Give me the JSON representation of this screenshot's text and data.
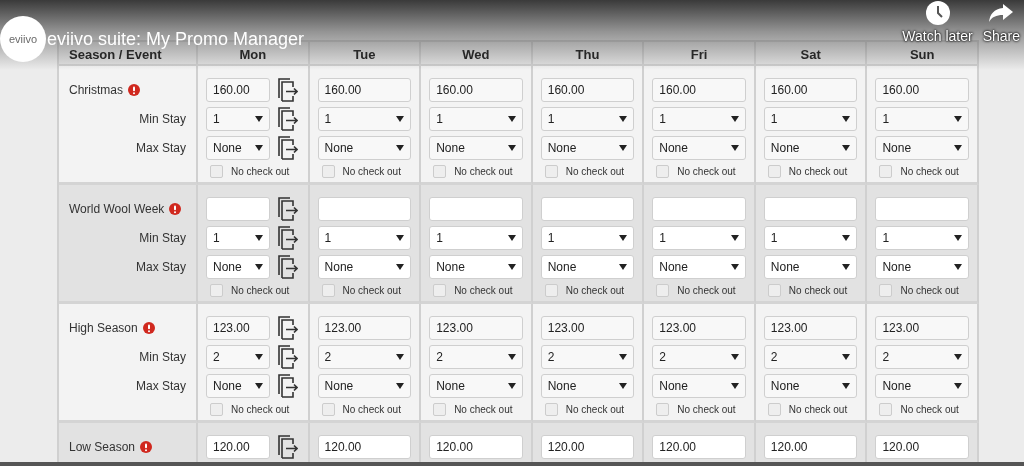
{
  "video": {
    "channel_logo": "eviivo",
    "title": "eviivo suite: My Promo Manager",
    "actions": [
      {
        "kind": "clock",
        "label": "Watch later"
      },
      {
        "kind": "share",
        "label": "Share"
      }
    ]
  },
  "table": {
    "columns": [
      "Season / Event",
      "Mon",
      "Tue",
      "Wed",
      "Thu",
      "Fri",
      "Sat",
      "Sun"
    ],
    "seasons": [
      {
        "name": "Christmas",
        "warning": true,
        "min_stay_label": "Min Stay",
        "max_stay_label": "Max Stay",
        "days": [
          {
            "rate": "160.00",
            "min_stay": "1",
            "max_stay": "None",
            "no_checkout_label": "No check out",
            "no_checkout": false
          },
          {
            "rate": "160.00",
            "min_stay": "1",
            "max_stay": "None",
            "no_checkout_label": "No check out",
            "no_checkout": false
          },
          {
            "rate": "160.00",
            "min_stay": "1",
            "max_stay": "None",
            "no_checkout_label": "No check out",
            "no_checkout": false
          },
          {
            "rate": "160.00",
            "min_stay": "1",
            "max_stay": "None",
            "no_checkout_label": "No check out",
            "no_checkout": false
          },
          {
            "rate": "160.00",
            "min_stay": "1",
            "max_stay": "None",
            "no_checkout_label": "No check out",
            "no_checkout": false
          },
          {
            "rate": "160.00",
            "min_stay": "1",
            "max_stay": "None",
            "no_checkout_label": "No check out",
            "no_checkout": false
          },
          {
            "rate": "160.00",
            "min_stay": "1",
            "max_stay": "None",
            "no_checkout_label": "No check out",
            "no_checkout": false
          }
        ]
      },
      {
        "name": "World Wool Week",
        "warning": true,
        "min_stay_label": "Min Stay",
        "max_stay_label": "Max Stay",
        "days": [
          {
            "min_stay": "1",
            "max_stay": "None",
            "no_checkout_label": "No check out",
            "no_checkout": false
          },
          {
            "min_stay": "1",
            "max_stay": "None",
            "no_checkout_label": "No check out",
            "no_checkout": false
          },
          {
            "min_stay": "1",
            "max_stay": "None",
            "no_checkout_label": "No check out",
            "no_checkout": false
          },
          {
            "min_stay": "1",
            "max_stay": "None",
            "no_checkout_label": "No check out",
            "no_checkout": false
          },
          {
            "min_stay": "1",
            "max_stay": "None",
            "no_checkout_label": "No check out",
            "no_checkout": false
          },
          {
            "min_stay": "1",
            "max_stay": "None",
            "no_checkout_label": "No check out",
            "no_checkout": false
          },
          {
            "min_stay": "1",
            "max_stay": "None",
            "no_checkout_label": "No check out",
            "no_checkout": false
          }
        ]
      },
      {
        "name": "High Season",
        "warning": true,
        "min_stay_label": "Min Stay",
        "max_stay_label": "Max Stay",
        "days": [
          {
            "rate": "123.00",
            "min_stay": "2",
            "max_stay": "None",
            "no_checkout_label": "No check out",
            "no_checkout": false
          },
          {
            "rate": "123.00",
            "min_stay": "2",
            "max_stay": "None",
            "no_checkout_label": "No check out",
            "no_checkout": false
          },
          {
            "rate": "123.00",
            "min_stay": "2",
            "max_stay": "None",
            "no_checkout_label": "No check out",
            "no_checkout": false
          },
          {
            "rate": "123.00",
            "min_stay": "2",
            "max_stay": "None",
            "no_checkout_label": "No check out",
            "no_checkout": false
          },
          {
            "rate": "123.00",
            "min_stay": "2",
            "max_stay": "None",
            "no_checkout_label": "No check out",
            "no_checkout": false
          },
          {
            "rate": "123.00",
            "min_stay": "2",
            "max_stay": "None",
            "no_checkout_label": "No check out",
            "no_checkout": false
          },
          {
            "rate": "123.00",
            "min_stay": "2",
            "max_stay": "None",
            "no_checkout_label": "No check out",
            "no_checkout": false
          }
        ]
      },
      {
        "name": "Low Season",
        "warning": true,
        "days": [
          {
            "rate": "120.00"
          },
          {
            "rate": "120.00"
          },
          {
            "rate": "120.00"
          },
          {
            "rate": "120.00"
          },
          {
            "rate": "120.00"
          },
          {
            "rate": "120.00"
          },
          {
            "rate": "120.00"
          }
        ]
      }
    ]
  }
}
